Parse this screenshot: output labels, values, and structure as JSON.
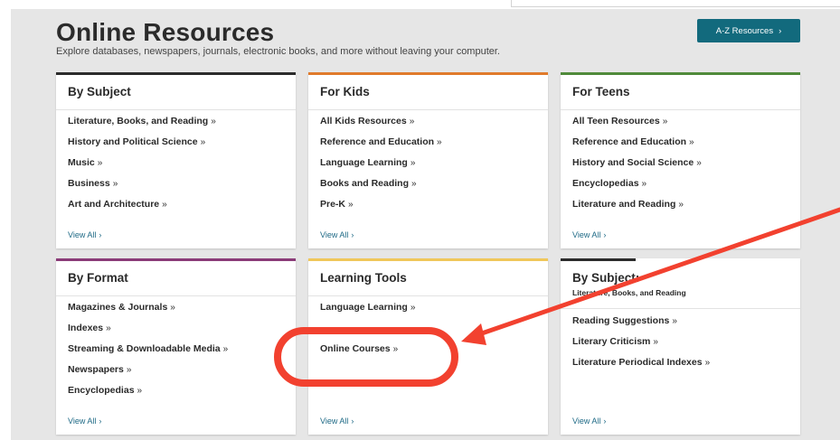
{
  "header": {
    "title": "Online Resources",
    "subtitle": "Explore databases, newspapers, journals, electronic books, and more without leaving your computer.",
    "az_button": "A-Z Resources",
    "az_chevron": "›"
  },
  "colors": {
    "accent_teal": "#126a7d",
    "by_subject_bar": "#2b2b2b",
    "for_kids_bar": "#e07a2b",
    "for_teens_bar": "#4f8a3a",
    "by_format_bar": "#8b3b78",
    "learning_tools_bar": "#f0c75a",
    "by_subject2_bar": "#2b2b2b",
    "annotation_red": "#f2412f"
  },
  "cards": [
    {
      "title": "By Subject",
      "links": [
        "Literature, Books, and Reading",
        "History and Political Science",
        "Music",
        "Business",
        "Art and Architecture"
      ],
      "view_all": "View All"
    },
    {
      "title": "For Kids",
      "links": [
        "All Kids Resources",
        "Reference and Education",
        "Language Learning",
        "Books and Reading",
        "Pre-K"
      ],
      "view_all": "View All"
    },
    {
      "title": "For Teens",
      "links": [
        "All Teen Resources",
        "Reference and Education",
        "History and Social Science",
        "Encyclopedias",
        "Literature and Reading"
      ],
      "view_all": "View All"
    },
    {
      "title": "By Format",
      "links": [
        "Magazines & Journals",
        "Indexes",
        "Streaming & Downloadable Media",
        "Newspapers",
        "Encyclopedias"
      ],
      "view_all": "View All"
    },
    {
      "title": "Learning Tools",
      "links": [
        "Language Learning",
        "",
        "Online Courses"
      ],
      "view_all": "View All"
    },
    {
      "title": "By Subject:",
      "subtitle": "Literature, Books, and Reading",
      "links": [
        "Reading Suggestions",
        "Literary Criticism",
        "Literature Periodical Indexes"
      ],
      "view_all": "View All"
    }
  ],
  "glyphs": {
    "link_chevron": "»",
    "view_chevron": "›"
  }
}
